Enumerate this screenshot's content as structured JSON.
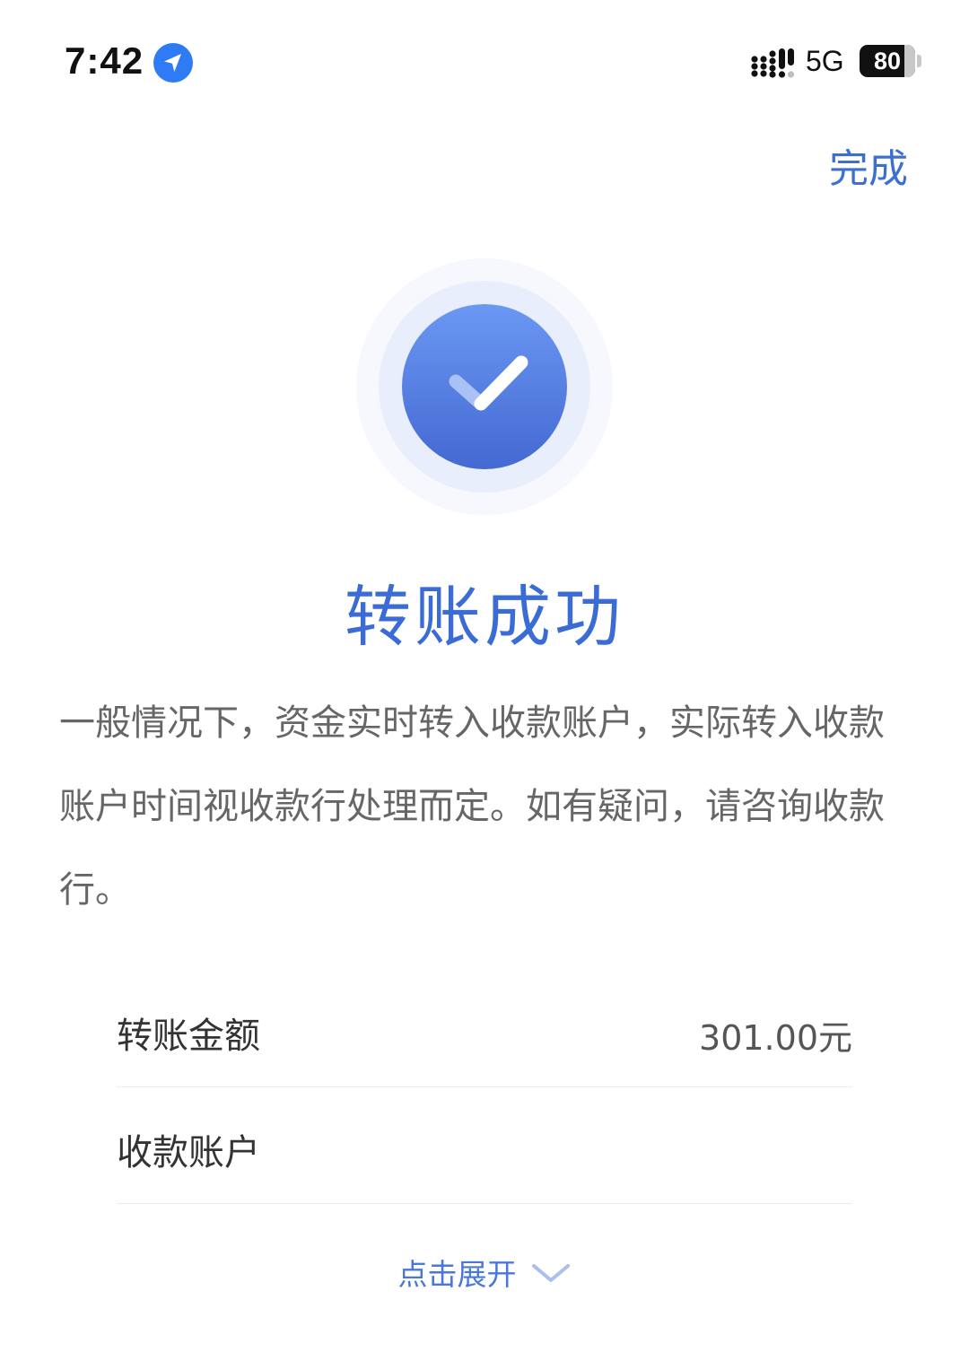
{
  "status_bar": {
    "time": "7:42",
    "network": "5G",
    "battery_level": "80",
    "battery_percent": 80,
    "location_icon": "location-arrow-icon",
    "signal_icon": "cellular-signal-icon"
  },
  "header": {
    "done_label": "完成"
  },
  "result": {
    "icon": "success-check-icon",
    "title": "转账成功",
    "notice": "一般情况下，资金实时转入收款账户，实际转入收款账户时间视收款行处理而定。如有疑问，请咨询收款行。"
  },
  "details": {
    "amount_label": "转账金额",
    "amount_value": "301.00元",
    "account_label": "收款账户",
    "account_value": ""
  },
  "expand": {
    "label": "点击展开",
    "icon": "chevron-down-icon"
  },
  "colors": {
    "accent": "#3d6fd1",
    "title": "#3b6bd4",
    "text_secondary": "#666666",
    "icon_gradient_top": "#6b98f3",
    "icon_gradient_bottom": "#4469d2"
  }
}
